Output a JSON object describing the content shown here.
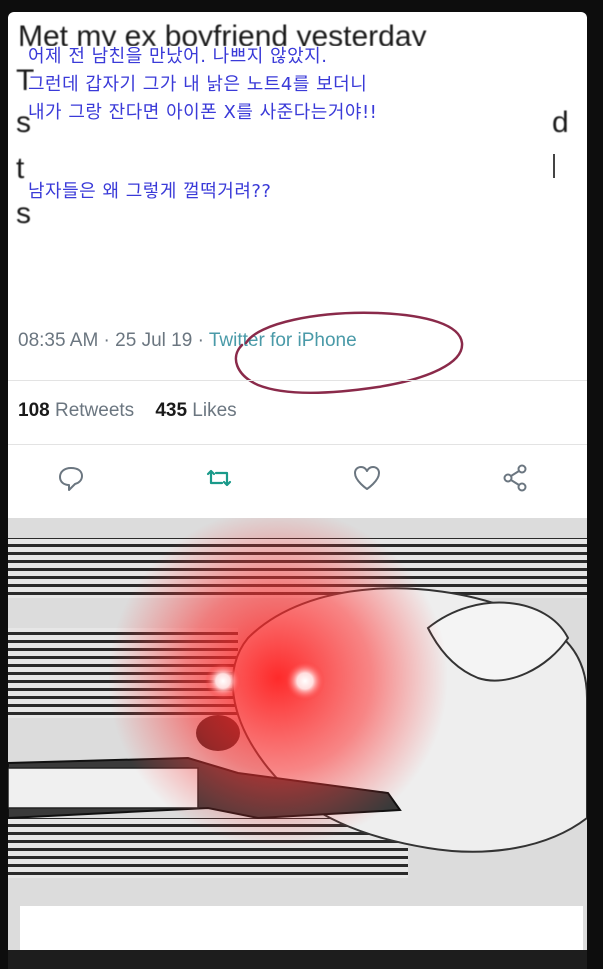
{
  "original_tweet": {
    "line1": "Met my ex boyfriend yesterday",
    "frag_T": "T",
    "frag_s": "s",
    "frag_d": "d",
    "frag_t": "t",
    "frag_s2": "s"
  },
  "overlay_korean": {
    "line1": "어제 전 남친을 만났어. 나쁘지 않았지.",
    "line2": "그런데 갑자기 그가 내 낡은 노트4를 보더니",
    "line3": "내가 그랑 잔다면 아이폰 X를 사준다는거야!!",
    "line4": "남자들은 왜 그렇게 껄떡거려??"
  },
  "tweet_meta": {
    "time": "08:35 AM",
    "separator": " · ",
    "date": "25 Jul 19",
    "date_sep": " · ",
    "source": "Twitter for iPhone"
  },
  "stats": {
    "retweets_count": "108",
    "retweets_label": "Retweets",
    "likes_count": "435",
    "likes_label": "Likes"
  },
  "icons": [
    "reply-icon",
    "retweet-icon",
    "like-icon",
    "share-icon"
  ],
  "colors": {
    "overlay_text": "#3a3ad8",
    "source_link": "#4a9aa8",
    "circle": "#8a2a4a",
    "retweet": "#1a9a8a",
    "glow": "#ff2020"
  }
}
